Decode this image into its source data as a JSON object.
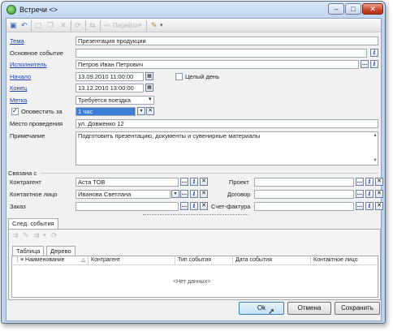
{
  "window": {
    "title": "Встречи <>",
    "min": "–",
    "max": "□",
    "close": "✕"
  },
  "toolbar": {
    "save_icon": "save-icon",
    "undo_icon": "undo-icon",
    "goto_label": "Перейти"
  },
  "form": {
    "subject_label": "Тема",
    "subject_value": "Презентация продукции",
    "main_event_label": "Основное событие",
    "main_event_value": "",
    "executor_label": "Исполнитель",
    "executor_value": "Петров Иван Петрович",
    "start_label": "Начало",
    "start_value": "13.09.2010 11:00:00",
    "allday_label": "Целый день",
    "end_label": "Конец",
    "end_value": "13.12.2010 13:00:00",
    "mark_label": "Метка",
    "mark_value": "Требуется поездка",
    "notify_label": "Оповестить за",
    "notify_value": "1 час",
    "place_label": "Место проведения",
    "place_value": "ул. Довженко 12",
    "note_label": "Примечание",
    "note_value": "Подготовить презентацию, документы и сувенирные материалы"
  },
  "links": {
    "group_label": "Связана с",
    "counterparty_label": "Контрагент",
    "counterparty_value": "Аста ТОВ",
    "contact_label": "Контактное лицо",
    "contact_value": "Иванова Светлана",
    "order_label": "Заказ",
    "order_value": "",
    "project_label": "Проект",
    "project_value": "",
    "contract_label": "Договор",
    "contract_value": "",
    "invoice_label": "Счет-фактура",
    "invoice_value": ""
  },
  "next_events": {
    "tab_label": "След. события",
    "subtab_table": "Таблица",
    "subtab_tree": "Дерево",
    "columns": [
      "Наименование",
      "Контрагент",
      "Тип события",
      "Дата события",
      "Контактное лицо"
    ],
    "empty_text": "<Нет данных>"
  },
  "buttons": {
    "ok": "Ok",
    "cancel": "Отмена",
    "save": "Сохранить"
  },
  "icons": {
    "ellipsis": "…",
    "info": "i",
    "clear": "✕",
    "calendar": "▦",
    "dropdown": "▾"
  }
}
